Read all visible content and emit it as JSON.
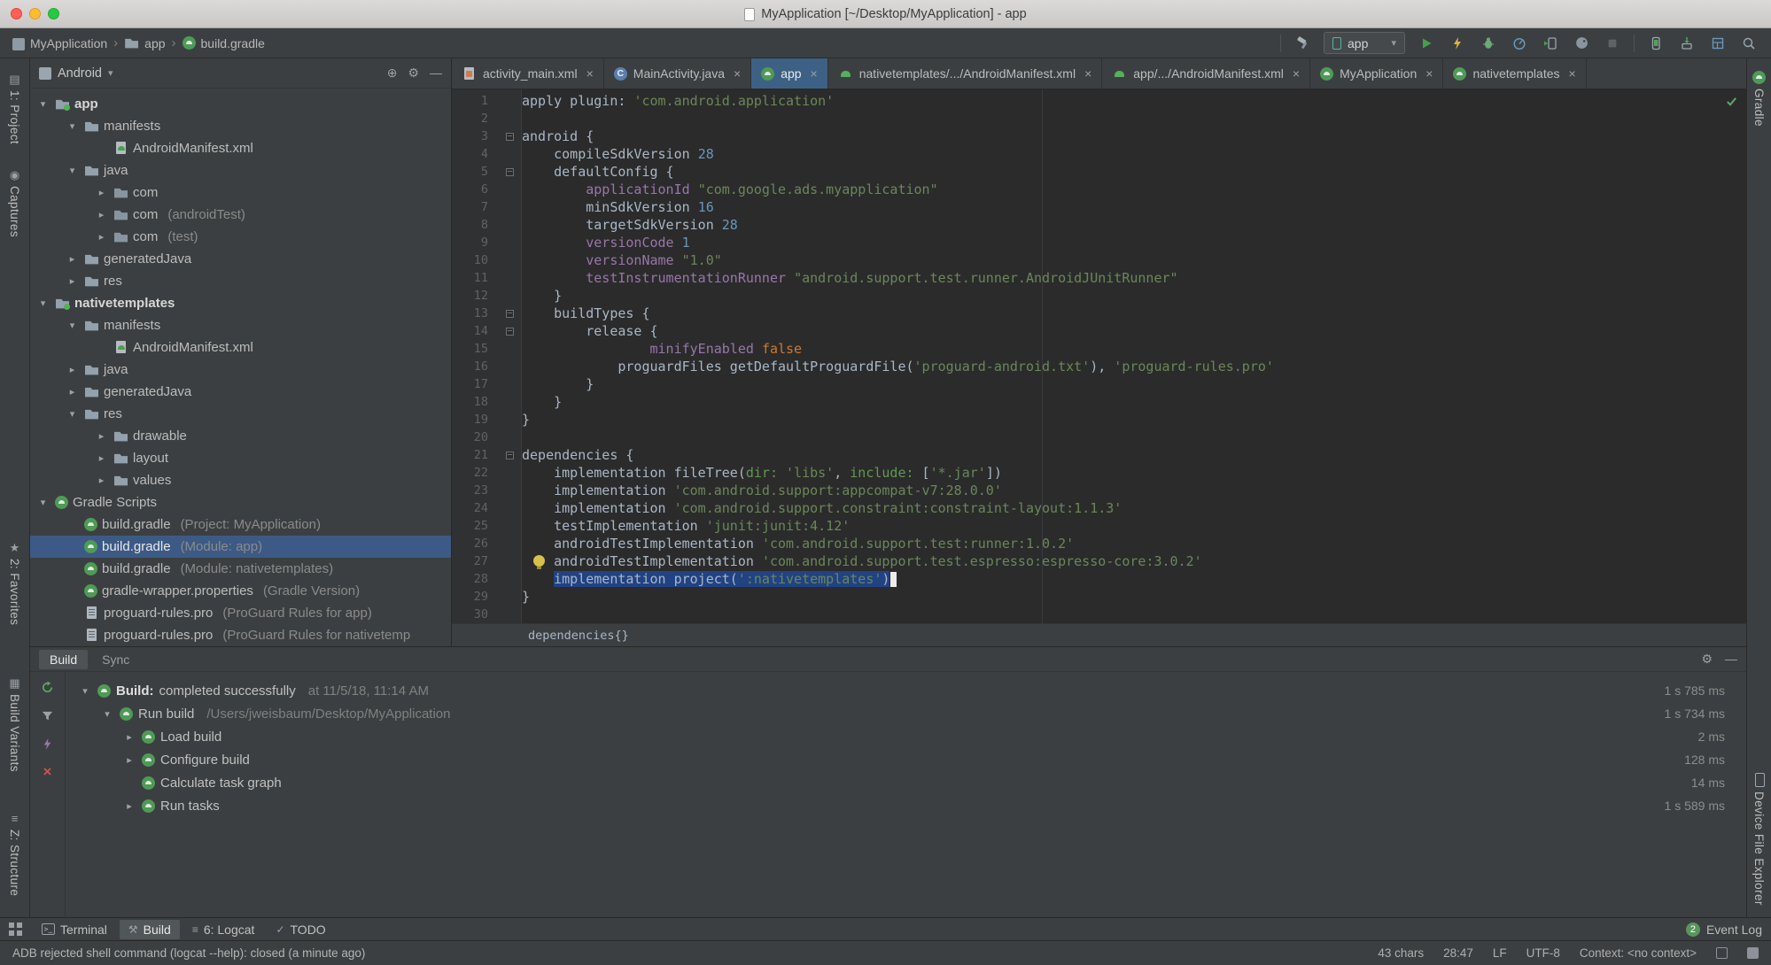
{
  "app": {
    "title": "MyApplication [~/Desktop/MyApplication] - app"
  },
  "toolbar": {
    "breadcrumbs": [
      {
        "icon": "project-sq",
        "label": "MyApplication"
      },
      {
        "icon": "folder",
        "label": "app"
      },
      {
        "icon": "gradle-file",
        "label": "build.gradle"
      }
    ],
    "run_config": "app"
  },
  "left_stripe": [
    {
      "icon": "▤",
      "label": "1: Project"
    },
    {
      "icon": "◉",
      "label": "Captures"
    },
    {
      "icon": "★",
      "label": "2: Favorites"
    },
    {
      "icon": "▦",
      "label": "Build Variants"
    },
    {
      "icon": "≡",
      "label": "Z: Structure"
    }
  ],
  "right_stripe": [
    {
      "icon": "gradle",
      "label": "Gradle"
    },
    {
      "icon": "device",
      "label": "Device File Explorer"
    }
  ],
  "project_panel": {
    "view_selector": "Android",
    "tree": [
      {
        "indent": 0,
        "arrow": "down",
        "icon": "module",
        "label": "app",
        "bold": true
      },
      {
        "indent": 1,
        "arrow": "down",
        "icon": "folder",
        "label": "manifests"
      },
      {
        "indent": 2,
        "arrow": "none",
        "icon": "android-file",
        "label": "AndroidManifest.xml"
      },
      {
        "indent": 1,
        "arrow": "down",
        "icon": "folder",
        "label": "java"
      },
      {
        "indent": 2,
        "arrow": "right",
        "icon": "package",
        "label": "com"
      },
      {
        "indent": 2,
        "arrow": "right",
        "icon": "package",
        "label": "com",
        "annotation": "(androidTest)"
      },
      {
        "indent": 2,
        "arrow": "right",
        "icon": "package",
        "label": "com",
        "annotation": "(test)"
      },
      {
        "indent": 1,
        "arrow": "right",
        "icon": "folder",
        "label": "generatedJava"
      },
      {
        "indent": 1,
        "arrow": "right",
        "icon": "res-folder",
        "label": "res"
      },
      {
        "indent": 0,
        "arrow": "down",
        "icon": "module",
        "label": "nativetemplates",
        "bold": true
      },
      {
        "indent": 1,
        "arrow": "down",
        "icon": "folder",
        "label": "manifests"
      },
      {
        "indent": 2,
        "arrow": "none",
        "icon": "android-file",
        "label": "AndroidManifest.xml"
      },
      {
        "indent": 1,
        "arrow": "right",
        "icon": "folder",
        "label": "java"
      },
      {
        "indent": 1,
        "arrow": "right",
        "icon": "folder",
        "label": "generatedJava"
      },
      {
        "indent": 1,
        "arrow": "down",
        "icon": "res-folder",
        "label": "res"
      },
      {
        "indent": 2,
        "arrow": "right",
        "icon": "folder",
        "label": "drawable"
      },
      {
        "indent": 2,
        "arrow": "right",
        "icon": "folder",
        "label": "layout"
      },
      {
        "indent": 2,
        "arrow": "right",
        "icon": "folder",
        "label": "values"
      },
      {
        "indent": 0,
        "arrow": "down",
        "icon": "gradle",
        "label": "Gradle Scripts"
      },
      {
        "indent": 1,
        "arrow": "none",
        "icon": "gradle-file",
        "label": "build.gradle",
        "annotation": "(Project: MyApplication)"
      },
      {
        "indent": 1,
        "arrow": "none",
        "icon": "gradle-file",
        "label": "build.gradle",
        "annotation": "(Module: app)",
        "selected": true
      },
      {
        "indent": 1,
        "arrow": "none",
        "icon": "gradle-file",
        "label": "build.gradle",
        "annotation": "(Module: nativetemplates)"
      },
      {
        "indent": 1,
        "arrow": "none",
        "icon": "gradle-wrapper",
        "label": "gradle-wrapper.properties",
        "annotation": "(Gradle Version)"
      },
      {
        "indent": 1,
        "arrow": "none",
        "icon": "proguard",
        "label": "proguard-rules.pro",
        "annotation": "(ProGuard Rules for app)"
      },
      {
        "indent": 1,
        "arrow": "none",
        "icon": "proguard",
        "label": "proguard-rules.pro",
        "annotation": "(ProGuard Rules for nativetemp"
      }
    ]
  },
  "editor": {
    "tabs": [
      {
        "icon": "layout-file",
        "label": "activity_main.xml"
      },
      {
        "icon": "java-class",
        "label": "MainActivity.java"
      },
      {
        "icon": "gradle",
        "label": "app",
        "selected": true
      },
      {
        "icon": "android",
        "label": "nativetemplates/.../AndroidManifest.xml"
      },
      {
        "icon": "android",
        "label": "app/.../AndroidManifest.xml"
      },
      {
        "icon": "gradle",
        "label": "MyApplication"
      },
      {
        "icon": "gradle",
        "label": "nativetemplates"
      }
    ],
    "breadcrumb": "dependencies{}",
    "folds": [
      3,
      5,
      13,
      14,
      21
    ],
    "bulb_line": 27,
    "caret_line": 28,
    "lines": [
      [
        [
          "p",
          "apply plugin: "
        ],
        [
          "s",
          "'com.android.application'"
        ]
      ],
      [],
      [
        [
          "p",
          "android {"
        ]
      ],
      [
        [
          "p",
          "    compileSdkVersion "
        ],
        [
          "n",
          "28"
        ]
      ],
      [
        [
          "p",
          "    defaultConfig {"
        ]
      ],
      [
        [
          "p",
          "        "
        ],
        [
          "pr",
          "applicationId"
        ],
        [
          "p",
          " "
        ],
        [
          "s",
          "\"com.google.ads.myapplication\""
        ]
      ],
      [
        [
          "p",
          "        minSdkVersion "
        ],
        [
          "n",
          "16"
        ]
      ],
      [
        [
          "p",
          "        targetSdkVersion "
        ],
        [
          "n",
          "28"
        ]
      ],
      [
        [
          "p",
          "        "
        ],
        [
          "pr",
          "versionCode"
        ],
        [
          "p",
          " "
        ],
        [
          "n",
          "1"
        ]
      ],
      [
        [
          "p",
          "        "
        ],
        [
          "pr",
          "versionName"
        ],
        [
          "p",
          " "
        ],
        [
          "s",
          "\"1.0\""
        ]
      ],
      [
        [
          "p",
          "        "
        ],
        [
          "pr",
          "testInstrumentationRunner"
        ],
        [
          "p",
          " "
        ],
        [
          "s",
          "\"android.support.test.runner.AndroidJUnitRunner\""
        ]
      ],
      [
        [
          "p",
          "    }"
        ]
      ],
      [
        [
          "p",
          "    buildTypes {"
        ]
      ],
      [
        [
          "p",
          "        release {"
        ]
      ],
      [
        [
          "p",
          "                "
        ],
        [
          "pr",
          "minifyEnabled"
        ],
        [
          "p",
          " "
        ],
        [
          "k",
          "false"
        ]
      ],
      [
        [
          "p",
          "            proguardFiles getDefaultProguardFile("
        ],
        [
          "s",
          "'proguard-android.txt'"
        ],
        [
          "p",
          "), "
        ],
        [
          "s",
          "'proguard-rules.pro'"
        ]
      ],
      [
        [
          "p",
          "        }"
        ]
      ],
      [
        [
          "p",
          "    }"
        ]
      ],
      [
        [
          "p",
          "}"
        ]
      ],
      [],
      [
        [
          "p",
          "dependencies {"
        ]
      ],
      [
        [
          "p",
          "    implementation fileTree("
        ],
        [
          "a",
          "dir:"
        ],
        [
          "p",
          " "
        ],
        [
          "s",
          "'libs'"
        ],
        [
          "p",
          ", "
        ],
        [
          "a",
          "include:"
        ],
        [
          "p",
          " ["
        ],
        [
          "s",
          "'*.jar'"
        ],
        [
          "p",
          "])"
        ]
      ],
      [
        [
          "p",
          "    implementation "
        ],
        [
          "s",
          "'com.android.support:appcompat-v7:28.0.0'"
        ]
      ],
      [
        [
          "p",
          "    implementation "
        ],
        [
          "s",
          "'com.android.support.constraint:constraint-layout:1.1.3'"
        ]
      ],
      [
        [
          "p",
          "    testImplementation "
        ],
        [
          "s",
          "'junit:junit:4.12'"
        ]
      ],
      [
        [
          "p",
          "    androidTestImplementation "
        ],
        [
          "s",
          "'com.android.support.test:runner:1.0.2'"
        ]
      ],
      [
        [
          "p",
          "    androidTestImplementation "
        ],
        [
          "s",
          "'com.android.support.test.espresso:espresso-core:3.0.2'"
        ]
      ],
      [
        [
          "p",
          "    "
        ],
        [
          "p",
          "implementation project(",
          "sel"
        ],
        [
          "s",
          "':nativetemplates'",
          "sel"
        ],
        [
          "p",
          ")",
          "sel"
        ]
      ],
      [
        [
          "p",
          "}"
        ]
      ],
      []
    ]
  },
  "build_panel": {
    "tabs": [
      "Build",
      "Sync"
    ],
    "rows": [
      {
        "indent": 0,
        "arrow": "down",
        "bold": "Build:",
        "text": " completed successfully",
        "note": "at 11/5/18, 11:14 AM",
        "time": "1 s 785 ms"
      },
      {
        "indent": 1,
        "arrow": "down",
        "text": "Run build",
        "note": "/Users/jweisbaum/Desktop/MyApplication",
        "time": "1 s 734 ms"
      },
      {
        "indent": 2,
        "arrow": "right",
        "text": "Load build",
        "time": "2 ms"
      },
      {
        "indent": 2,
        "arrow": "right",
        "text": "Configure build",
        "time": "128 ms"
      },
      {
        "indent": 2,
        "arrow": "none",
        "text": "Calculate task graph",
        "time": "14 ms"
      },
      {
        "indent": 2,
        "arrow": "right",
        "text": "Run tasks",
        "time": "1 s 589 ms"
      }
    ]
  },
  "bottom_bar": {
    "items": [
      {
        "icon": "terminal",
        "label": "Terminal"
      },
      {
        "icon": "hammer",
        "label": "Build",
        "selected": true
      },
      {
        "icon": "logcat",
        "label": "6: Logcat"
      },
      {
        "icon": "todo",
        "label": "TODO"
      }
    ],
    "event_log": {
      "badge": "2",
      "label": "Event Log"
    }
  },
  "status_bar": {
    "message": "ADB rejected shell command (logcat --help): closed (a minute ago)",
    "items": [
      "43 chars",
      "28:47",
      "LF",
      "UTF-8",
      "Context: <no context>"
    ]
  },
  "colors": {
    "tree_selection": "#3c5a85",
    "editor_selection": "#214283",
    "tab_selected": "#3d6185",
    "run_green": "#46a046",
    "string_green": "#6a8759",
    "keyword_orange": "#cc7832",
    "number_blue": "#6897bb",
    "property_purple": "#9876aa",
    "gradle_green": "#4f9a57"
  }
}
